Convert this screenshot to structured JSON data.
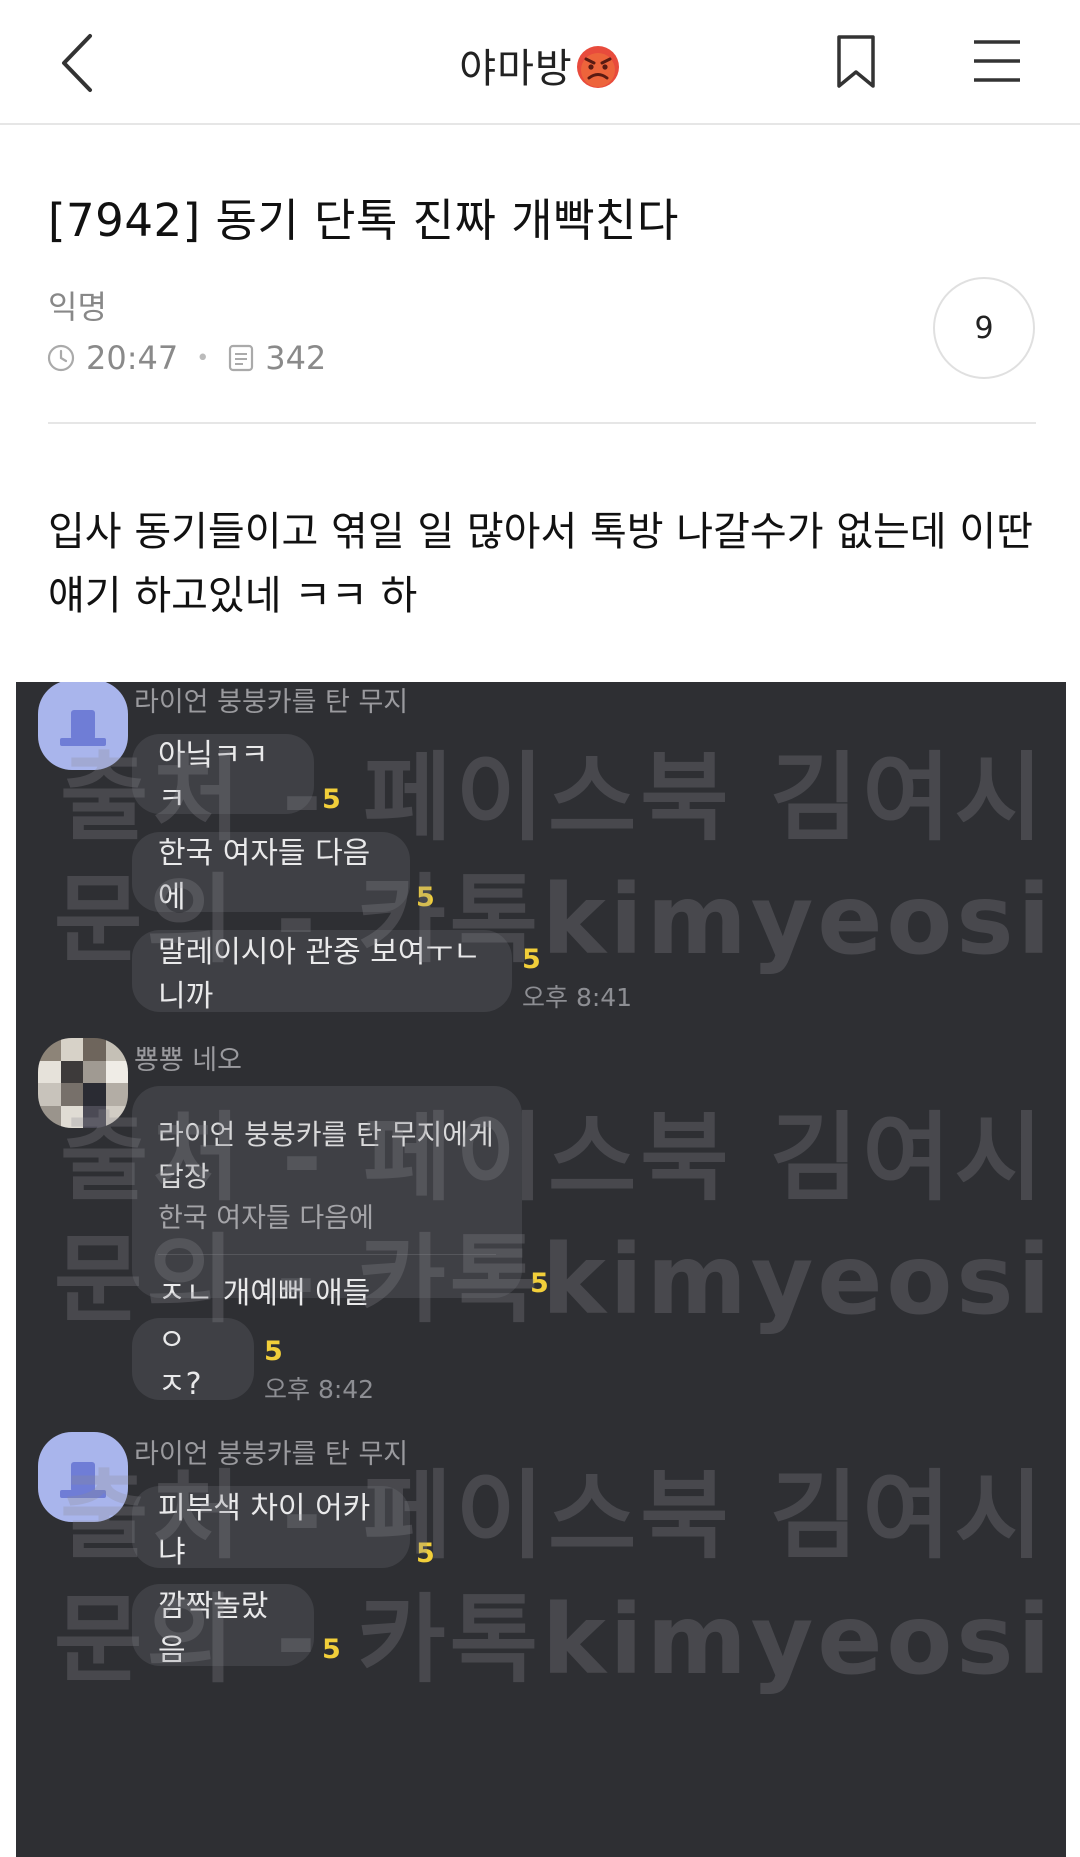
{
  "header": {
    "back_icon": "chevron-left-icon",
    "title": "야마방",
    "title_emoji": "angry-face",
    "bookmark_icon": "bookmark-icon",
    "menu_icon": "hamburger-menu-icon"
  },
  "post": {
    "title": "[7942] 동기 단톡 진짜 개빡친다",
    "author": "익명",
    "time": "20:47",
    "views": "342",
    "comment_count": "9",
    "body_lines": [
      "입사 동기들이고 엮일 일 많아서 톡방 나갈수가 없는데 이딴",
      "얘기 하고있네 ㅋㅋ 하"
    ]
  },
  "chat": {
    "colors": {
      "background": "#2e2f33",
      "bubble": "#3f4045",
      "read_count": "#f2cf3a"
    },
    "watermark": {
      "line1": "출처 - 페이스북 김여시",
      "line2": "문의 - 카톡kimyeosi"
    },
    "groups": [
      {
        "sender": "라이언 붕붕카를 탄 무지",
        "messages": [
          {
            "text": "아닠ㅋㅋㅋ",
            "read": "5"
          },
          {
            "text": "한국 여자들 다음에",
            "read": "5"
          },
          {
            "text": "말레이시아 관중 보여ㅜㄴ니까",
            "read": "5",
            "time": "오후 8:41"
          }
        ]
      },
      {
        "sender": "뿅뿅 네오",
        "reply": {
          "head": "라이언 붕붕카를 탄 무지에게 답장",
          "quote": "한국 여자들 다음에",
          "text": "ㅈㄴ 개예뻐 애들",
          "read": "5"
        },
        "messages": [
          {
            "text": "ㅇㅈ?",
            "read": "5",
            "time": "오후 8:42"
          }
        ]
      },
      {
        "sender": "라이언 붕붕카를 탄 무지",
        "messages": [
          {
            "text": "피부색 차이 어카냐",
            "read": "5"
          },
          {
            "text": "깜짝놀랐음",
            "read": "5"
          }
        ]
      }
    ]
  }
}
